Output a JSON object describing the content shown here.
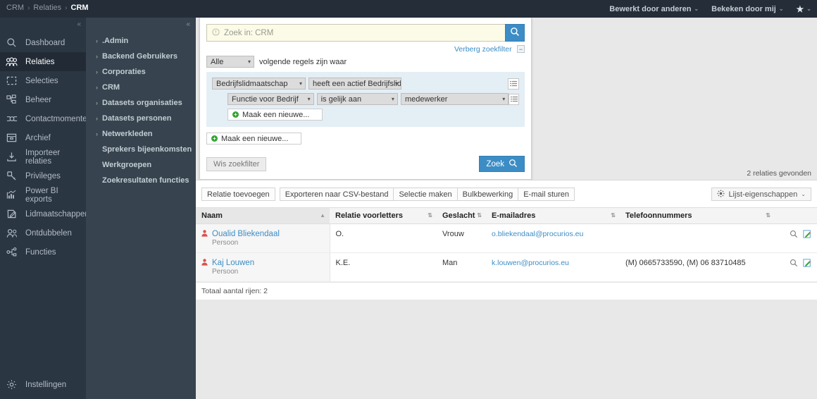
{
  "topbar": {
    "breadcrumb": [
      "CRM",
      "Relaties",
      "CRM"
    ],
    "separator": "›",
    "edited_by_others": "Bewerkt door anderen",
    "viewed_by_me": "Bekeken door mij",
    "star_glyph": "★",
    "caret_glyph": "⌄"
  },
  "rail": {
    "collapse_glyph": "«",
    "items": [
      {
        "label": "Dashboard",
        "icon": "search-icon",
        "active": false
      },
      {
        "label": "Relaties",
        "icon": "people-icon",
        "active": true
      },
      {
        "label": "Selecties",
        "icon": "dashed-square-icon",
        "active": false
      },
      {
        "label": "Beheer",
        "icon": "org-chart-icon",
        "active": false
      },
      {
        "label": "Contactmomenten",
        "icon": "contact-moments-icon",
        "active": false
      },
      {
        "label": "Archief",
        "icon": "archive-box-icon",
        "active": false
      },
      {
        "label": "Importeer relaties",
        "icon": "import-download-icon",
        "active": false
      },
      {
        "label": "Privileges",
        "icon": "key-icon",
        "active": false
      },
      {
        "label": "Power BI exports",
        "icon": "bar-chart-icon",
        "active": false
      },
      {
        "label": "Lidmaatschappen",
        "icon": "membership-card-icon",
        "active": false
      },
      {
        "label": "Ontdubbelen",
        "icon": "two-persons-icon",
        "active": false
      },
      {
        "label": "Functies",
        "icon": "hierarchy-icon",
        "active": false
      }
    ],
    "bottom": {
      "label": "Instellingen",
      "icon": "gear-icon"
    }
  },
  "submenu": {
    "collapse_glyph": "«",
    "bullet": "›",
    "items": [
      {
        "label": ".Admin",
        "bullet": true
      },
      {
        "label": "Backend Gebruikers",
        "bullet": true
      },
      {
        "label": "Corporaties",
        "bullet": true
      },
      {
        "label": "CRM",
        "bullet": true
      },
      {
        "label": "Datasets organisaties",
        "bullet": true
      },
      {
        "label": "Datasets personen",
        "bullet": true
      },
      {
        "label": "Netwerkleden",
        "bullet": true
      },
      {
        "label": "Sprekers bijeenkomsten",
        "bullet": false
      },
      {
        "label": "Werkgroepen",
        "bullet": false
      },
      {
        "label": "Zoekresultaten functies",
        "bullet": false
      }
    ]
  },
  "search_panel": {
    "search_placeholder": "Zoek in: CRM",
    "search_value": "",
    "warn_glyph": "!",
    "search_button_icon": "magnifier-icon",
    "hide_filter_link": "Verberg zoekfilter",
    "hide_filter_box_glyph": "−",
    "match_select_value": "Alle",
    "match_label": "volgende regels zijn waar",
    "rows": [
      {
        "field": "Bedrijfslidmaatschap",
        "operator": "heeft een actief Bedrijfslidmaatsc",
        "value": null
      },
      {
        "field": "Functie voor Bedrijf",
        "operator": "is gelijk aan",
        "value": "medewerker"
      }
    ],
    "new_inner_label": "Maak een nieuwe...",
    "new_outer_label": "Maak een nieuwe...",
    "clear_button": "Wis zoekfilter",
    "search_button": "Zoek"
  },
  "results": {
    "found_text": "2 relaties gevonden",
    "toolbar": [
      "Relatie toevoegen",
      "Exporteren naar CSV-bestand",
      "Selectie maken",
      "Bulkbewerking",
      "E-mail sturen"
    ],
    "list_properties": "Lijst-eigenschappen",
    "columns": [
      {
        "label": "Naam",
        "sorted": true,
        "mark": "▲"
      },
      {
        "label": "Relatie voorletters",
        "sorted": false,
        "mark": "⇅"
      },
      {
        "label": "Geslacht",
        "sorted": false,
        "mark": "⇅"
      },
      {
        "label": "E-mailadres",
        "sorted": false,
        "mark": "⇅"
      },
      {
        "label": "Telefoonnummers",
        "sorted": false,
        "mark": "⇅"
      },
      {
        "label": "",
        "sorted": false,
        "mark": ""
      }
    ],
    "rows": [
      {
        "name": "Oualid Bliekendaal",
        "type": "Persoon",
        "initials": "O.",
        "gender": "Vrouw",
        "email": "o.bliekendaal@procurios.eu",
        "phones": ""
      },
      {
        "name": "Kaj Louwen",
        "type": "Persoon",
        "initials": "K.E.",
        "gender": "Man",
        "email": "k.louwen@procurios.eu",
        "phones": "(M) 0665733590, (M) 06 83710485"
      }
    ],
    "row_actions": {
      "view": "magnifier-icon",
      "edit": "edit-pencil-icon"
    },
    "total_text": "Totaal aantal rijen: 2"
  },
  "colors": {
    "accent_blue": "#3c8dc5",
    "topbar_dark": "#242d38",
    "rail_dark": "#2b3643",
    "submenu_dark": "#37444f",
    "filter_group_blue": "#e4eef5",
    "search_yellow": "#fbfbe8",
    "green_plus": "#31a531"
  }
}
